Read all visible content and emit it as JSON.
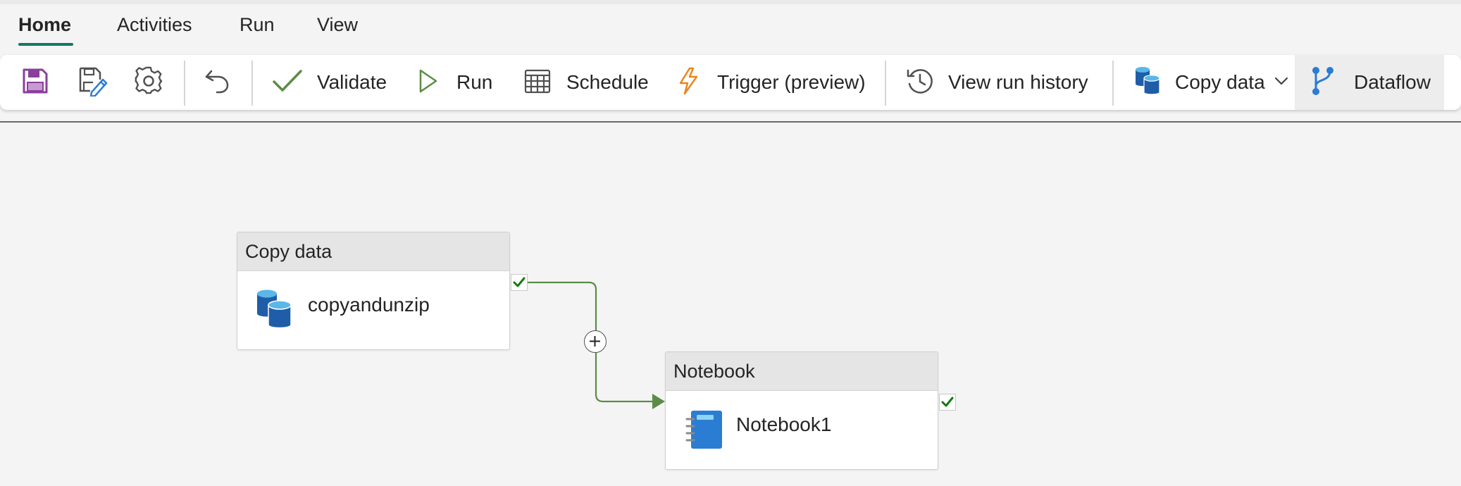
{
  "tabs": [
    {
      "label": "Home",
      "active": true
    },
    {
      "label": "Activities"
    },
    {
      "label": "Run"
    },
    {
      "label": "View"
    }
  ],
  "toolbar": {
    "save_icon": "save-icon",
    "save_as_icon": "save-edit-icon",
    "settings_icon": "gear-icon",
    "undo_icon": "undo-icon",
    "validate": "Validate",
    "run": "Run",
    "schedule": "Schedule",
    "trigger": "Trigger (preview)",
    "view_run_history": "View run history",
    "copy_data": "Copy data",
    "dataflow": "Dataflow"
  },
  "activities": [
    {
      "type": "Copy data",
      "name": "copyandunzip",
      "icon": "database-icon"
    },
    {
      "type": "Notebook",
      "name": "Notebook1",
      "icon": "notebook-icon"
    }
  ],
  "colors": {
    "accent": "#117865",
    "success_green": "#5b8c47",
    "save_purple": "#8a3f9c",
    "trigger_orange": "#e8871e",
    "db_blue": "#1f5da8",
    "notebook_blue": "#2b7cd3"
  }
}
